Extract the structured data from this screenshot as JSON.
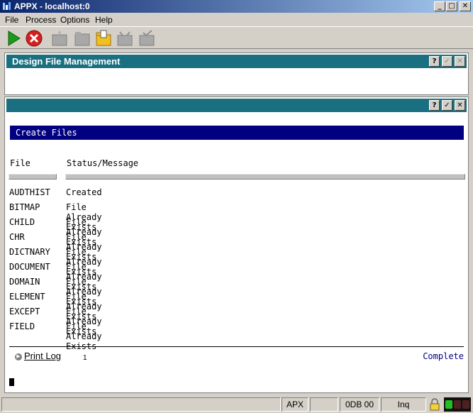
{
  "window": {
    "title": "APPX - localhost:0",
    "minimize_glyph": "_",
    "maximize_glyph": "□",
    "close_glyph": "✕"
  },
  "menu": [
    "File",
    "Process",
    "Options",
    "Help"
  ],
  "toolbar": {
    "icons": [
      "play-icon",
      "stop-icon",
      "new-record-icon",
      "folder-icon",
      "open-folder-icon",
      "inbox-icon",
      "tray-check-icon"
    ]
  },
  "panel1": {
    "title": "Design File Management",
    "help_glyph": "?",
    "ok_glyph": "✓",
    "close_glyph": "✕"
  },
  "panel2": {
    "help_glyph": "?",
    "ok_glyph": "✓",
    "close_glyph": "✕",
    "section_title": "Create Files",
    "col_file": "File",
    "col_status": "Status/Message",
    "rows": [
      {
        "file": "AUDTHIST",
        "status": "Created"
      },
      {
        "file": "BITMAP",
        "status": "File Already Exists"
      },
      {
        "file": "CHILD",
        "status": "File Already Exists"
      },
      {
        "file": "CHR",
        "status": "File Already Exists"
      },
      {
        "file": "DICTNARY",
        "status": "File Already Exists"
      },
      {
        "file": "DOCUMENT",
        "status": "File Already Exists"
      },
      {
        "file": "DOMAIN",
        "status": "File Already Exists"
      },
      {
        "file": "ELEMENT",
        "status": "File Already Exists"
      },
      {
        "file": "EXCEPT",
        "status": "File Already Exists"
      },
      {
        "file": "FIELD",
        "status": "File Already Exists"
      }
    ],
    "print_log_label": "Print Log",
    "count": "1",
    "complete_label": "Complete"
  },
  "status": {
    "app": "APX",
    "db": "0DB 00",
    "mode": "Inq"
  },
  "colors": {
    "panel_header": "#1a7080",
    "section_bar": "#000080"
  }
}
